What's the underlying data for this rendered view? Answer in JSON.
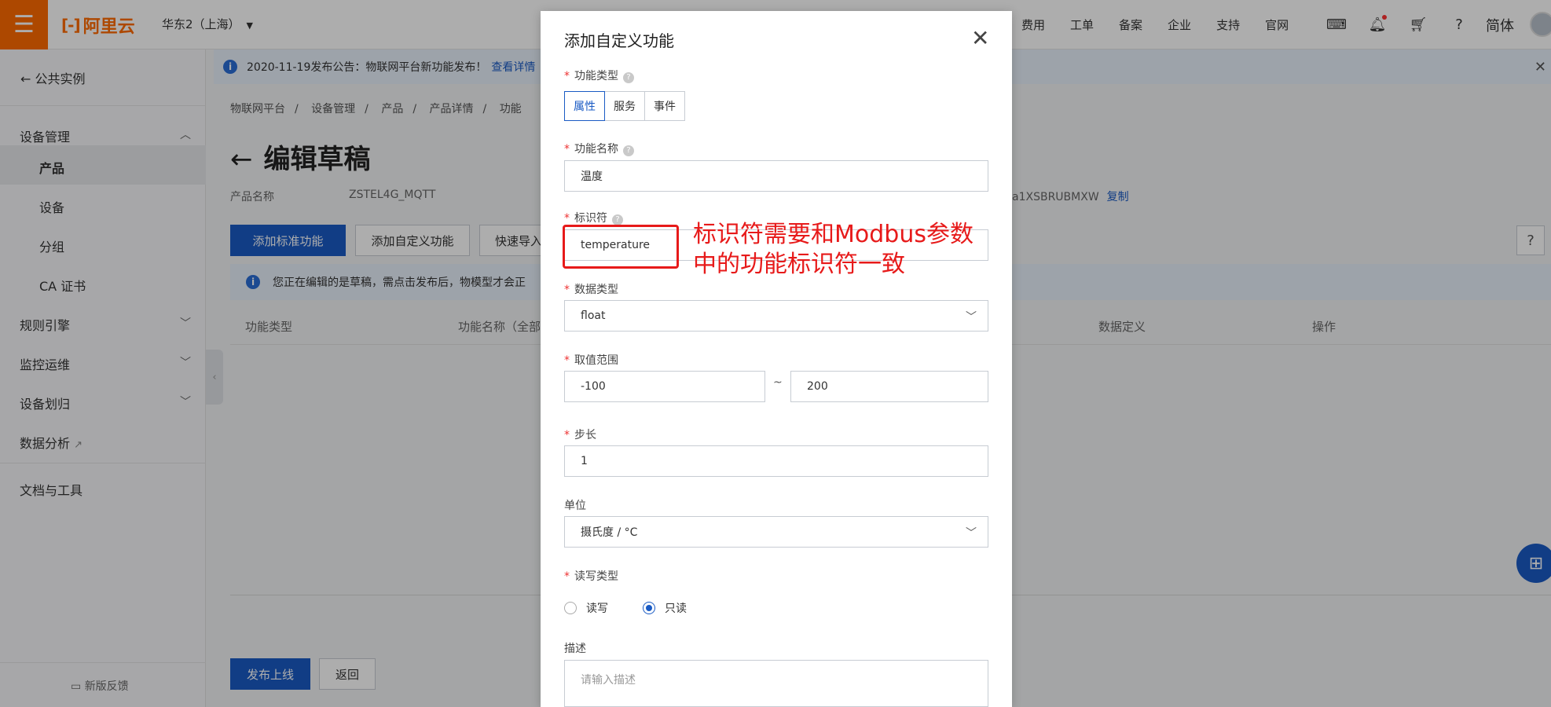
{
  "topbar": {
    "menu_icon": "menu-icon",
    "logo_mark": "[-]",
    "logo_text": "阿里云",
    "region": "华东2（上海）",
    "nav": [
      "费用",
      "工单",
      "备案",
      "企业",
      "支持",
      "官网"
    ],
    "lang": "简体"
  },
  "sidebar": {
    "back_label": "公共实例",
    "group_device": "设备管理",
    "items": [
      "产品",
      "设备",
      "分组",
      "CA 证书"
    ],
    "rules": "规则引擎",
    "ops": "监控运维",
    "assign": "设备划归",
    "analytics": "数据分析",
    "docs": "文档与工具",
    "feedback": "新版反馈"
  },
  "notice": {
    "text": "2020-11-19发布公告：物联网平台新功能发布！",
    "link": "查看详情"
  },
  "breadcrumb": [
    "物联网平台",
    "/",
    "设备管理",
    "/",
    "产品",
    "/",
    "产品详情",
    "/",
    "功能"
  ],
  "page": {
    "title": "编辑草稿",
    "product_label": "产品名称",
    "product_value": "ZSTEL4G_MQTT",
    "productkey_value": "a1XSBRUBMXW",
    "copy": "复制"
  },
  "buttons": {
    "add_std": "添加标准功能",
    "add_custom": "添加自定义功能",
    "quick_import": "快速导入",
    "help": "?"
  },
  "draft": {
    "text": "您正在编辑的是草稿，需点击发布后，物模型才会正"
  },
  "table": {
    "headers": [
      "功能类型",
      "功能名称（全部",
      "数据定义",
      "操作"
    ]
  },
  "footer": {
    "publish": "发布上线",
    "back": "返回"
  },
  "modal": {
    "title": "添加自定义功能",
    "type_label": "功能类型",
    "types": [
      "属性",
      "服务",
      "事件"
    ],
    "type_selected": "属性",
    "name_label": "功能名称",
    "name_value": "温度",
    "id_label": "标识符",
    "id_value": "temperature",
    "dtype_label": "数据类型",
    "dtype_value": "float",
    "range_label": "取值范围",
    "range_min": "-100",
    "range_sep": "~",
    "range_max": "200",
    "step_label": "步长",
    "step_value": "1",
    "unit_label": "单位",
    "unit_value": "摄氏度 / °C",
    "rw_label": "读写类型",
    "rw_options": [
      "读写",
      "只读"
    ],
    "rw_selected": "只读",
    "desc_label": "描述",
    "desc_placeholder": "请输入描述"
  },
  "annotation": {
    "text_line1": "标识符需要和Modbus参数",
    "text_line2": "中的功能标识符一致",
    "color": "#e71a1a"
  },
  "colors": {
    "brand": "#ff6a00",
    "primary": "#1a5bc4"
  }
}
